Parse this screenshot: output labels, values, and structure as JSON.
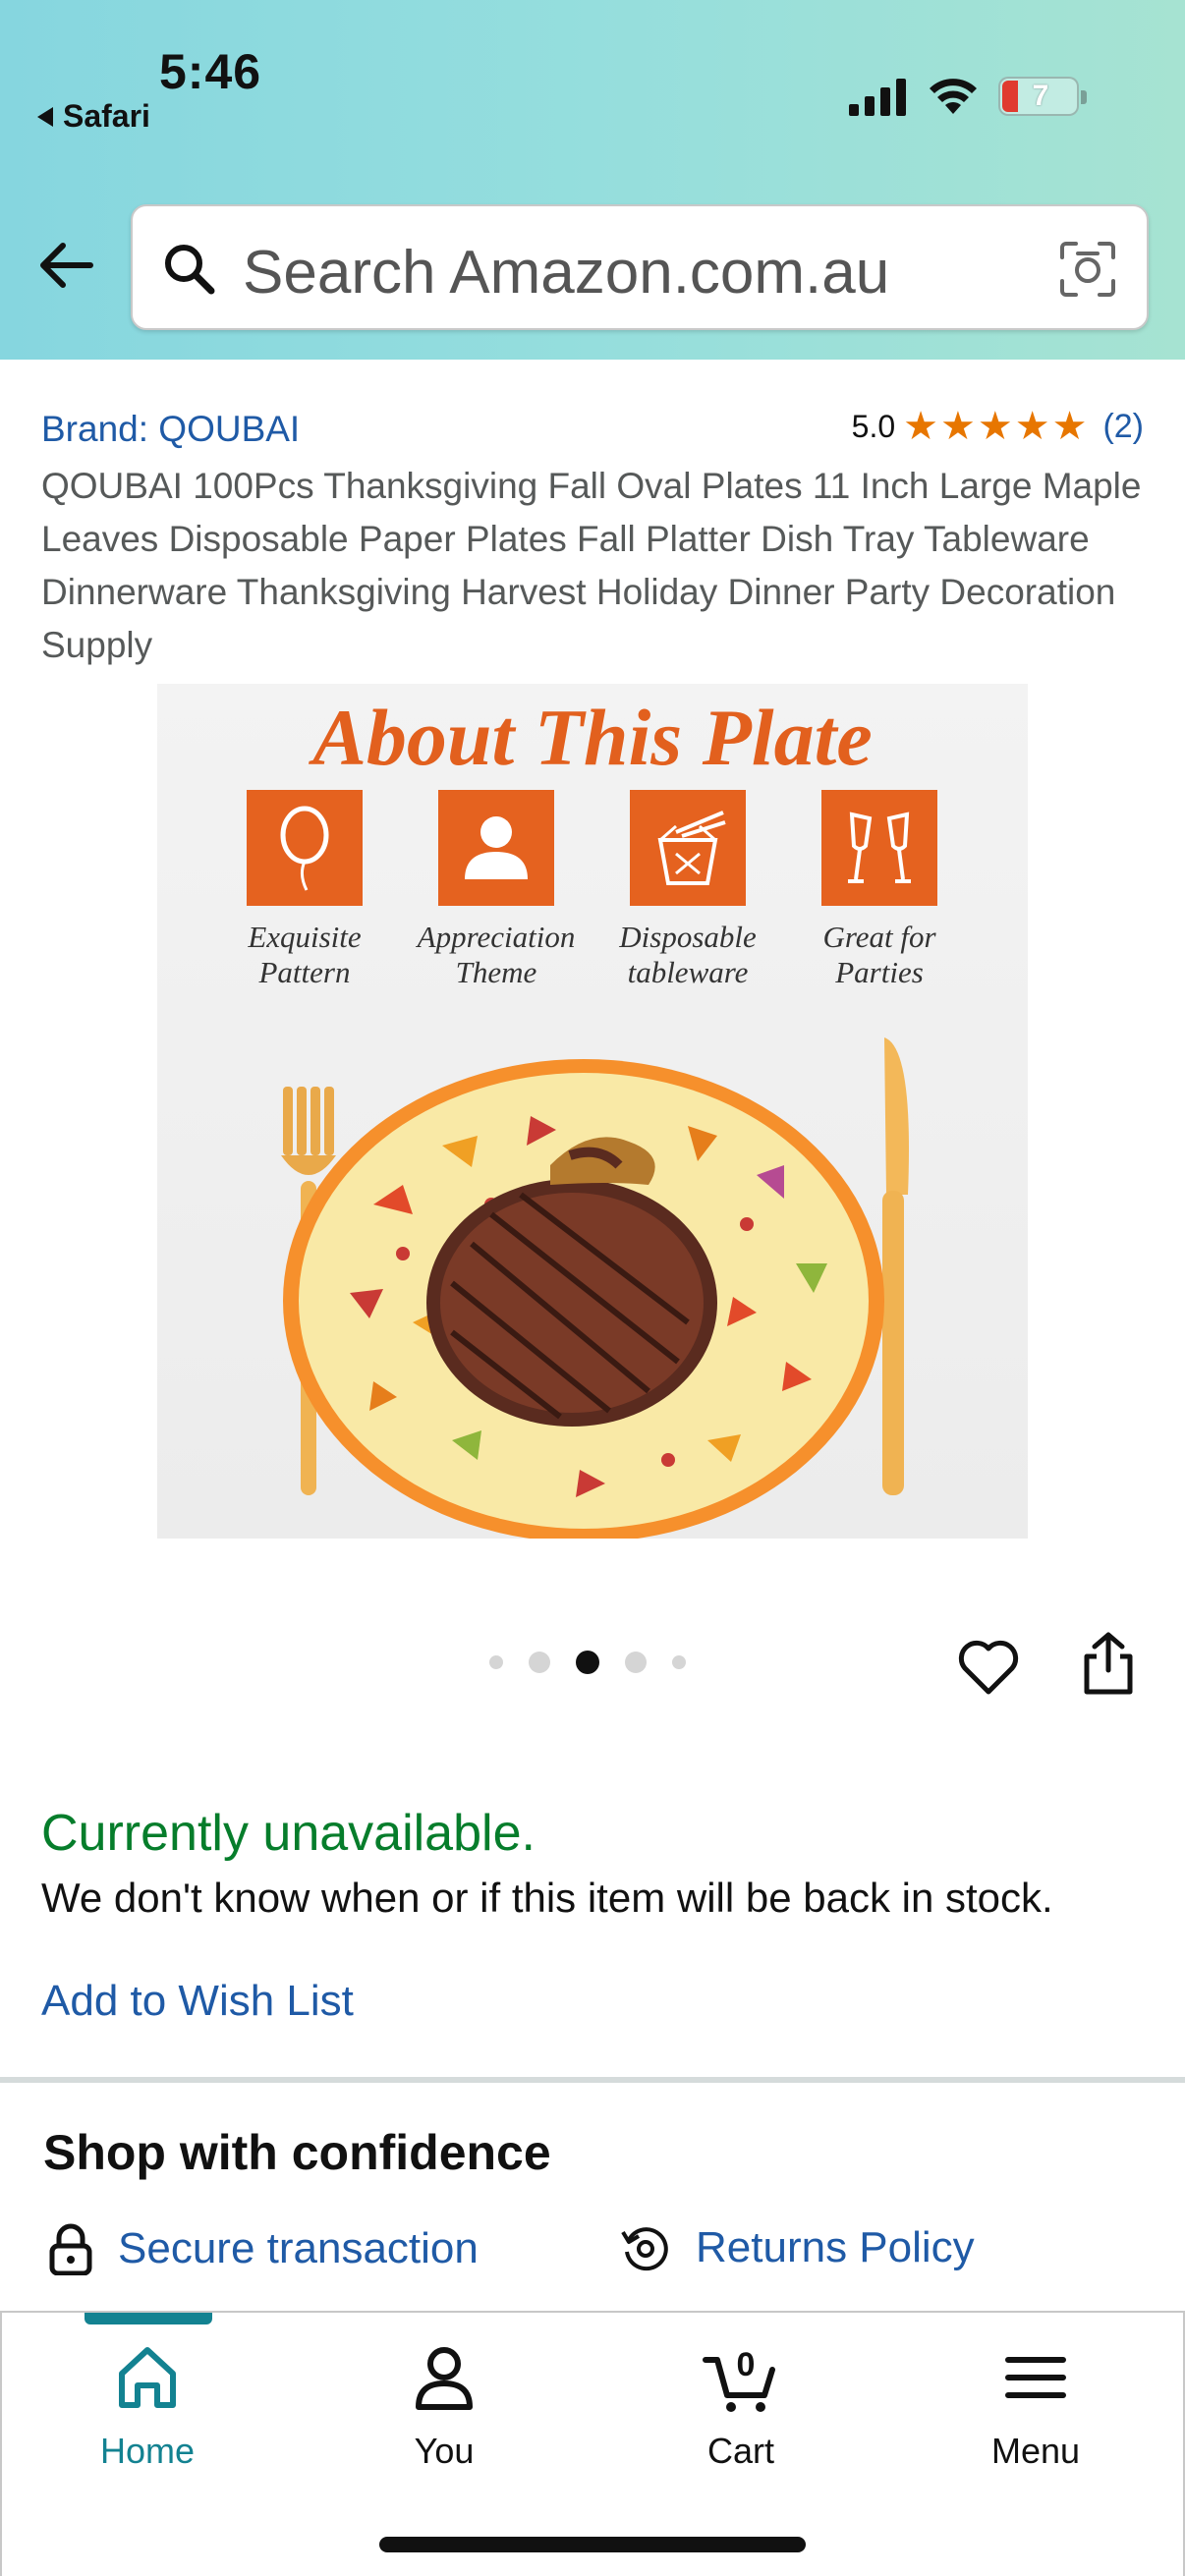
{
  "status_bar": {
    "time": "5:46",
    "back_app": "Safari",
    "battery": "7"
  },
  "search": {
    "placeholder": "Search Amazon.com.au"
  },
  "product": {
    "brand": "Brand: QOUBAI",
    "rating_score": "5.0",
    "rating_count": "(2)",
    "stars": 5,
    "title": "QOUBAI 100Pcs Thanksgiving Fall Oval Plates 11 Inch Large Maple Leaves Disposable Paper Plates Fall Platter Dish Tray Tableware Dinnerware Thanksgiving Harvest Holiday Dinner Party Decoration Supply",
    "image": {
      "heading": "About This Plate",
      "features": [
        {
          "line1": "Exquisite",
          "line2": "Pattern",
          "icon": "balloon-icon"
        },
        {
          "line1": "Appreciation",
          "line2": "Theme",
          "icon": "person-icon"
        },
        {
          "line1": "Disposable",
          "line2": "tableware",
          "icon": "takeout-box-icon"
        },
        {
          "line1": "Great for",
          "line2": "Parties",
          "icon": "champagne-glasses-icon"
        }
      ]
    },
    "carousel": {
      "total": 5,
      "active_index": 2
    }
  },
  "availability": {
    "status": "Currently unavailable.",
    "message": "We don't know when or if this item will be back in stock.",
    "wishlist_label": "Add to Wish List"
  },
  "confidence": {
    "heading": "Shop with confidence",
    "secure": "Secure transaction",
    "returns": "Returns Policy"
  },
  "tabbar": {
    "home": "Home",
    "you": "You",
    "cart": "Cart",
    "cart_count": "0",
    "menu": "Menu",
    "active_color": "#138291"
  },
  "colors": {
    "link": "#1f5aa6",
    "available_green": "#067d2b",
    "star": "#e77600",
    "brand_orange": "#e5621f"
  }
}
